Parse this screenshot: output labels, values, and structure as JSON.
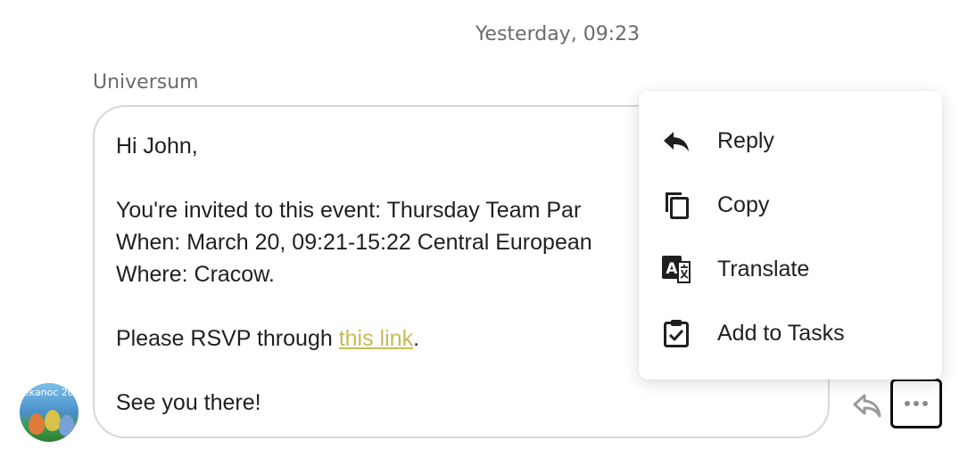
{
  "conversation": {
    "timestamp": "Yesterday, 09:23",
    "sender_name": "Universum",
    "avatar_text": "ekanoc 20",
    "message": {
      "greeting": "Hi John,",
      "line_invite": "You're invited to this event: Thursday Team Par",
      "line_when": "When: March 20, 09:21-15:22 Central European",
      "line_where": "Where: Cracow.",
      "rsvp_prefix": "Please RSVP through ",
      "rsvp_link": "this link",
      "rsvp_suffix": ".",
      "closing": "See you there!"
    },
    "link_color": "#c5bb56"
  },
  "actions": {
    "reply_icon": "reply-icon",
    "more_icon": "more-horizontal-icon"
  },
  "context_menu": {
    "items": [
      {
        "label": "Reply",
        "icon": "reply-icon"
      },
      {
        "label": "Copy",
        "icon": "copy-icon"
      },
      {
        "label": "Translate",
        "icon": "translate-icon"
      },
      {
        "label": "Add to Tasks",
        "icon": "add-to-tasks-icon"
      }
    ]
  }
}
